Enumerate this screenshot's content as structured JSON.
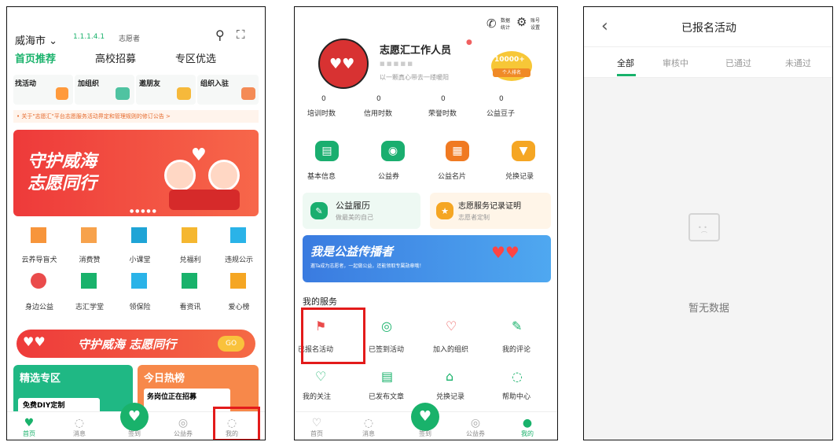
{
  "p1": {
    "city": "威海市",
    "level": "1.1.1.4.1",
    "role": "志愿者",
    "tabs": [
      "首页推荐",
      "高校招募",
      "专区优选"
    ],
    "quick": [
      {
        "label": "找活动",
        "color": "#ff9a3c"
      },
      {
        "label": "加组织",
        "color": "#4fc3a1"
      },
      {
        "label": "邀朋友",
        "color": "#f6b93b"
      },
      {
        "label": "组织入驻",
        "color": "#f48b56"
      }
    ],
    "notice": "关于\"志愿汇\"平台志愿服务活动界定和管理规则的修订公告 >",
    "banner_title1": "守护威海",
    "banner_title2": "志愿同行",
    "grid": [
      {
        "label": "云养导盲犬",
        "icon": "dog-icon",
        "color": "#f7953b",
        "glyph": "◉"
      },
      {
        "label": "消费赞",
        "icon": "thumb-icon",
        "color": "#f7a24c",
        "glyph": "✋"
      },
      {
        "label": "小课堂",
        "icon": "video-icon",
        "color": "#1fa4d6",
        "glyph": "▶"
      },
      {
        "label": "兑福利",
        "icon": "gift-icon",
        "color": "#f5b730",
        "glyph": "▥"
      },
      {
        "label": "违规公示",
        "icon": "notice-icon",
        "color": "#2ab3e8",
        "glyph": "▤"
      },
      {
        "label": "身边公益",
        "icon": "heart-icon",
        "color": "#ea4b4b",
        "glyph": "♥"
      },
      {
        "label": "志汇学堂",
        "icon": "school-icon",
        "color": "#19b26b",
        "glyph": "▲"
      },
      {
        "label": "领保险",
        "icon": "shield-icon",
        "color": "#2ab3e8",
        "glyph": "◈"
      },
      {
        "label": "看资讯",
        "icon": "news-icon",
        "color": "#19b26b",
        "glyph": "▦"
      },
      {
        "label": "爱心榜",
        "icon": "rank-icon",
        "color": "#f5a623",
        "glyph": "♛"
      }
    ],
    "banner2": "守护威海 志愿同行",
    "banner2_btn": "GO",
    "card_left_title": "精选专区",
    "card_left_sub": "免费DIY定制",
    "card_right_title": "今日热榜",
    "card_right_sub": "务岗位正在招募",
    "nav": [
      "首页",
      "消息",
      "签到",
      "公益券",
      "我的"
    ]
  },
  "p2": {
    "top_right1": "数据\n统计",
    "top_right2": "账号\n设置",
    "name": "志愿汇工作人员",
    "motto": "以一颗真心带去一缕暖阳",
    "badge_top": "10000+",
    "badge_bottom": "个人排名",
    "stats": [
      {
        "value": "0",
        "label": "培训时数"
      },
      {
        "value": "0",
        "label": "信用时数"
      },
      {
        "value": "0",
        "label": "荣誉时数"
      },
      {
        "value": "0",
        "label": "公益豆子"
      }
    ],
    "tools": [
      {
        "label": "基本信息",
        "icon": "id-card-icon",
        "color": "#1aae6f"
      },
      {
        "label": "公益券",
        "icon": "camera-icon",
        "color": "#1aae6f"
      },
      {
        "label": "公益名片",
        "icon": "card-icon",
        "color": "#f07a22"
      },
      {
        "label": "兑换记录",
        "icon": "cart-icon",
        "color": "#f5a623"
      }
    ],
    "card1_title": "公益履历",
    "card1_sub": "做最美的自己",
    "card2_title": "志愿服务记录证明",
    "card2_sub": "志愿者定制",
    "promo_title": "我是公益传播者",
    "promo_sub": "邀Ta成为志愿者，一起做公益，还能领取专属勋章哦！",
    "section": "我的服务",
    "services": [
      {
        "label": "已报名活动",
        "icon": "flag-icon",
        "glyph": "⚑"
      },
      {
        "label": "已签到活动",
        "icon": "location-icon",
        "glyph": "◎"
      },
      {
        "label": "加入的组织",
        "icon": "heart-icon",
        "glyph": "♡"
      },
      {
        "label": "我的评论",
        "icon": "edit-icon",
        "glyph": "✎"
      },
      {
        "label": "我的关注",
        "icon": "heart-outline-icon",
        "glyph": "♡"
      },
      {
        "label": "已发布文章",
        "icon": "article-icon",
        "glyph": "▤"
      },
      {
        "label": "兑换记录",
        "icon": "gift-icon",
        "glyph": "⌂"
      },
      {
        "label": "帮助中心",
        "icon": "help-icon",
        "glyph": "◌"
      }
    ],
    "nav": [
      "首页",
      "消息",
      "签到",
      "公益券",
      "我的"
    ]
  },
  "p3": {
    "title": "已报名活动",
    "tabs": [
      "全部",
      "审核中",
      "已通过",
      "未通过"
    ],
    "empty": "暂无数据"
  }
}
